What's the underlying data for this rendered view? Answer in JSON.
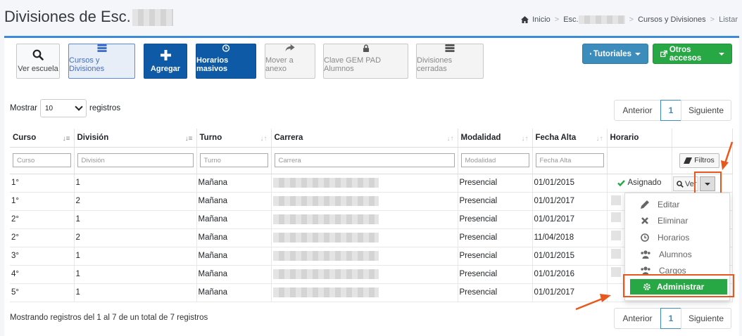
{
  "header": {
    "title": "Divisiones de Esc.",
    "breadcrumb": {
      "home": "Inicio",
      "school": "Esc.",
      "section": "Cursos y Divisiones",
      "current": "Listar"
    }
  },
  "toolbar": {
    "ver_escuela": "Ver escuela",
    "cursos_divisiones": "Cursos y Divisiones",
    "agregar": "Agregar",
    "horarios_masivos": "Horarios masivos",
    "mover_anexo": "Mover a anexo",
    "clave_gem": "Clave GEM PAD Alumnos",
    "divisiones_cerradas": "Divisiones cerradas",
    "tutoriales": "Tutoriales",
    "otros_accesos": "Otros accesos"
  },
  "length_control": {
    "prefix": "Mostrar",
    "value": "10",
    "suffix": "registros"
  },
  "pagination": {
    "prev": "Anterior",
    "page": "1",
    "next": "Siguiente"
  },
  "table": {
    "columns": [
      "Curso",
      "División",
      "Turno",
      "Carrera",
      "Modalidad",
      "Fecha Alta",
      "Horario"
    ],
    "filters": [
      "Curso",
      "División",
      "Turno",
      "Carrera",
      "Modalidad",
      "Fecha Alta"
    ],
    "filtros_label": "Filtros",
    "rows": [
      {
        "curso": "1°",
        "division": "1",
        "turno": "Mañana",
        "modalidad": "Presencial",
        "fecha": "01/01/2015",
        "horario": "Asignado"
      },
      {
        "curso": "1°",
        "division": "2",
        "turno": "Mañana",
        "modalidad": "Presencial",
        "fecha": "01/01/2017",
        "horario": ""
      },
      {
        "curso": "2°",
        "division": "1",
        "turno": "Mañana",
        "modalidad": "Presencial",
        "fecha": "01/01/2017",
        "horario": ""
      },
      {
        "curso": "2°",
        "division": "2",
        "turno": "Mañana",
        "modalidad": "Presencial",
        "fecha": "11/04/2018",
        "horario": ""
      },
      {
        "curso": "3°",
        "division": "1",
        "turno": "Mañana",
        "modalidad": "Presencial",
        "fecha": "01/01/2015",
        "horario": ""
      },
      {
        "curso": "4°",
        "division": "1",
        "turno": "Mañana",
        "modalidad": "Presencial",
        "fecha": "01/01/2016",
        "horario": ""
      },
      {
        "curso": "5°",
        "division": "1",
        "turno": "Mañana",
        "modalidad": "Presencial",
        "fecha": "01/01/2017",
        "horario": ""
      }
    ]
  },
  "row_actions": {
    "ver": "Ver"
  },
  "dropdown_menu": {
    "items": [
      "Editar",
      "Eliminar",
      "Horarios",
      "Alumnos",
      "Cargos"
    ],
    "active": "Administrar"
  },
  "info": "Mostrando registros del 1 al 7 de un total de 7 registros",
  "colors": {
    "primary": "#0f5aa6",
    "success": "#28a745",
    "info": "#3c8dbc",
    "highlight": "#e8581c"
  }
}
